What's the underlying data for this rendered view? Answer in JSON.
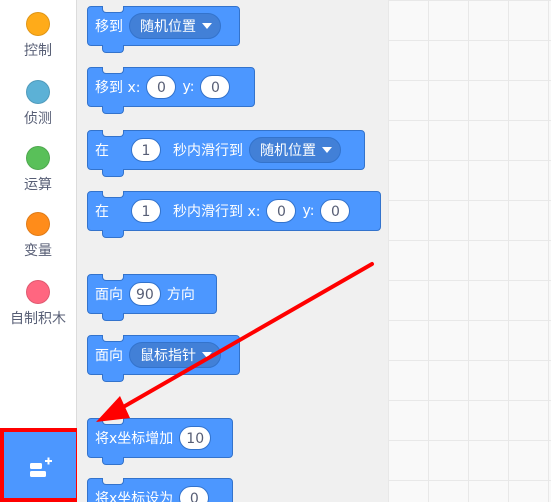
{
  "categories": [
    {
      "label": "控制",
      "color": "#ffab19",
      "icon": "control-dot-icon"
    },
    {
      "label": "侦测",
      "color": "#5cb1d6",
      "icon": "sensing-dot-icon"
    },
    {
      "label": "运算",
      "color": "#59c059",
      "icon": "operators-dot-icon"
    },
    {
      "label": "变量",
      "color": "#ff8c1a",
      "icon": "variables-dot-icon"
    },
    {
      "label": "自制积木",
      "color": "#ff6680",
      "icon": "my-blocks-dot-icon"
    }
  ],
  "extension_button": {
    "icon": "add-extension-icon",
    "color": "#4c97ff",
    "highlight": "#ff0000"
  },
  "blocks": {
    "goto": {
      "label": "移到",
      "dropdown": "随机位置"
    },
    "goto_xy": {
      "label": "移到 x:",
      "x": "0",
      "y_label": "y:",
      "y": "0"
    },
    "glide_to": {
      "label": "在",
      "secs": "1",
      "mid": "秒内滑行到",
      "dropdown": "随机位置"
    },
    "glide_xy": {
      "label": "在",
      "secs": "1",
      "mid": "秒内滑行到 x:",
      "x": "0",
      "y_label": "y:",
      "y": "0"
    },
    "point_dir": {
      "label": "面向",
      "value": "90",
      "suffix": "方向"
    },
    "point_towards": {
      "label": "面向",
      "dropdown": "鼠标指针"
    },
    "change_x": {
      "label": "将x坐标增加",
      "value": "10"
    },
    "set_x": {
      "label": "将x坐标设为",
      "value": "0"
    }
  },
  "colors": {
    "motion": "#4c97ff",
    "arrow": "#ff0000"
  }
}
